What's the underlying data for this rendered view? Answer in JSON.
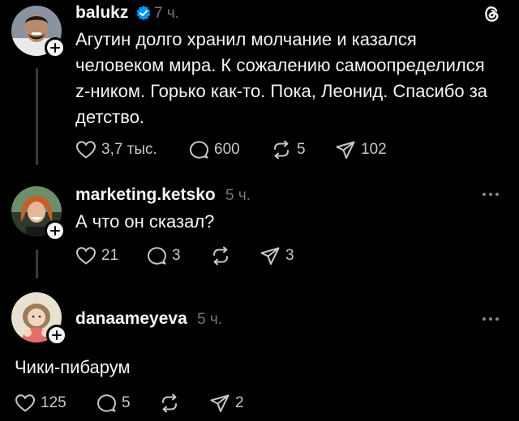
{
  "posts": [
    {
      "username": "balukz",
      "verified": true,
      "time": "7 ч.",
      "text_lines": [
        "Агутин долго хранил молчание и казался",
        "человеком мира. К сожалению самоопределился",
        "z-ником. Горько как-то. Пока, Леонид. Спасибо за",
        "детство."
      ],
      "likes": "3,7 тыс.",
      "replies": "600",
      "reposts": "5",
      "shares": "102"
    },
    {
      "username": "marketing.ketsko",
      "time": "5 ч.",
      "text": "А что он сказал?",
      "likes": "21",
      "replies": "3",
      "reposts": "",
      "shares": "3"
    },
    {
      "username": "danaameyeva",
      "time": "5 ч.",
      "text": "Чики-пибарум",
      "likes": "125",
      "replies": "5",
      "reposts": "",
      "shares": "2"
    }
  ],
  "colors": {
    "background": "#000000",
    "text": "#f3f5f7",
    "muted": "#777777",
    "verified": "#0095f6"
  },
  "icons": [
    "threads-logo-icon",
    "verified-badge-icon",
    "plus-icon",
    "heart-icon",
    "comment-icon",
    "repost-icon",
    "share-icon",
    "more-icon"
  ]
}
